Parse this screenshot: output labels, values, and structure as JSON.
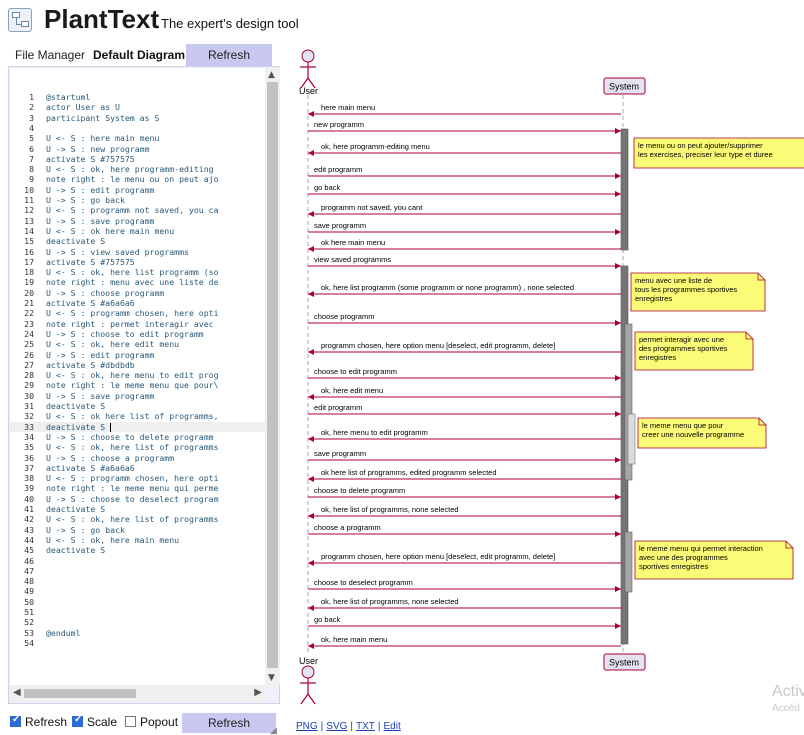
{
  "header": {
    "title": "PlantText",
    "tagline": "The expert's design tool",
    "logo_icon": "diagram-logo-icon"
  },
  "tabs": {
    "file_manager": "File Manager",
    "default_diagram": "Default Diagram",
    "refresh": "Refresh"
  },
  "editor": {
    "current_line": 33,
    "lines": [
      "@startuml",
      "actor User as U",
      "participant System as S",
      "",
      "U <- S : here main menu",
      "U -> S : new programm",
      "activate S #757575",
      "U <- S : ok, here programm-editing",
      "note right : le menu ou on peut ajo",
      "U -> S : edit programm",
      "U -> S : go back",
      "U <- S : programm not saved, you ca",
      "U -> S : save programm",
      "U <- S : ok here main menu",
      "deactivate S",
      "U -> S : view saved programms",
      "activate S #757575",
      "U <- S : ok, here list programm (so",
      "note right : menu avec une liste de",
      "U -> S : choose programm",
      "activate S #a6a6a6",
      "U <- S : programm chosen, here opti",
      "note right : permet interagir avec",
      "U -> S : choose to edit programm",
      "U <- S : ok, here edit menu",
      "U -> S : edit programm",
      "activate S #dbdbdb",
      "U <- S : ok, here menu to edit prog",
      "note right : le meme menu que pour\\",
      "U -> S : save programm",
      "deactivate S",
      "U <- S : ok here list of programms,",
      "deactivate S ",
      "U -> S : choose to delete programm",
      "U <- S : ok, here list of programms",
      "U -> S : choose a programm",
      "activate S #a6a6a6",
      "U <- S : programm chosen, here opti",
      "note right : le meme menu qui perme",
      "U -> S : choose to deselect program",
      "deactivate S",
      "U <- S : ok, here list of programms",
      "U -> S : go back",
      "U <- S : ok, here main menu",
      "deactivate S",
      "",
      "",
      "",
      "",
      "",
      "",
      "",
      "@enduml",
      ""
    ]
  },
  "bottom": {
    "refresh_label": "Refresh",
    "scale_label": "Scale",
    "popout_label": "Popout",
    "refresh_button": "Refresh",
    "refresh_checked": true,
    "scale_checked": true,
    "popout_checked": false
  },
  "diagram": {
    "actor_label": "User",
    "participant_label": "System",
    "messages": [
      {
        "dir": "left",
        "text": "here main menu"
      },
      {
        "dir": "right",
        "text": "new programm"
      },
      {
        "dir": "left",
        "text": "ok, here programm-editing menu"
      },
      {
        "dir": "right",
        "text": "edit programm"
      },
      {
        "dir": "right",
        "text": "go back"
      },
      {
        "dir": "left",
        "text": "programm not saved, you cant"
      },
      {
        "dir": "right",
        "text": "save programm"
      },
      {
        "dir": "left",
        "text": "ok here main menu"
      },
      {
        "dir": "right",
        "text": "view saved programms"
      },
      {
        "dir": "left",
        "text": "ok, here list programm (some programm or none programm) , none selected"
      },
      {
        "dir": "right",
        "text": "choose programm"
      },
      {
        "dir": "left",
        "text": "programm chosen, here option menu [deselect, edit programm, delete]"
      },
      {
        "dir": "right",
        "text": "choose to edit programm"
      },
      {
        "dir": "left",
        "text": "ok, here edit menu"
      },
      {
        "dir": "right",
        "text": "edit programm"
      },
      {
        "dir": "left",
        "text": "ok, here menu to edit programm"
      },
      {
        "dir": "right",
        "text": "save programm"
      },
      {
        "dir": "left",
        "text": "ok here list of programms, edited programm selected"
      },
      {
        "dir": "right",
        "text": "choose to delete programm"
      },
      {
        "dir": "left",
        "text": "ok, here list of programms, none selected"
      },
      {
        "dir": "right",
        "text": "choose a programm"
      },
      {
        "dir": "left",
        "text": "programm chosen, here option menu [deselect, edit programm, delete]"
      },
      {
        "dir": "right",
        "text": "choose to deselect programm"
      },
      {
        "dir": "left",
        "text": "ok, here list of programms, none selected"
      },
      {
        "dir": "right",
        "text": "go back"
      },
      {
        "dir": "left",
        "text": "ok, here main menu"
      }
    ],
    "notes": [
      {
        "lines": [
          "le menu ou on peut ajouter/supprimer",
          "les exercises, preciser leur type et duree"
        ]
      },
      {
        "lines": [
          "menu avec une liste de",
          "tous les programmes sportives",
          "enregistres"
        ]
      },
      {
        "lines": [
          "permet interagir avec une",
          "des programmes sportives",
          "enregistres"
        ]
      },
      {
        "lines": [
          "le meme menu que pour",
          "creer une nouvelle programme"
        ]
      },
      {
        "lines": [
          "le meme menu qui permet interaction",
          "avec une des programmes",
          "sportives enregistres"
        ]
      }
    ],
    "colors": {
      "lifeline": "#a8a8a8",
      "participant_fill": "#e2e2f0",
      "participant_border": "#a80036",
      "note_fill": "#fbfb77",
      "note_border": "#a80036",
      "activation_dark": "#757575",
      "activation_mid": "#a6a6a6",
      "activation_light": "#dbdbdb",
      "arrow": "#a80036"
    }
  },
  "watermark": {
    "title": "Activ",
    "subtitle": "Accéd"
  },
  "export": {
    "png": "PNG",
    "svg": "SVG",
    "txt": "TXT",
    "edit": "Edit",
    "sep": "|"
  }
}
